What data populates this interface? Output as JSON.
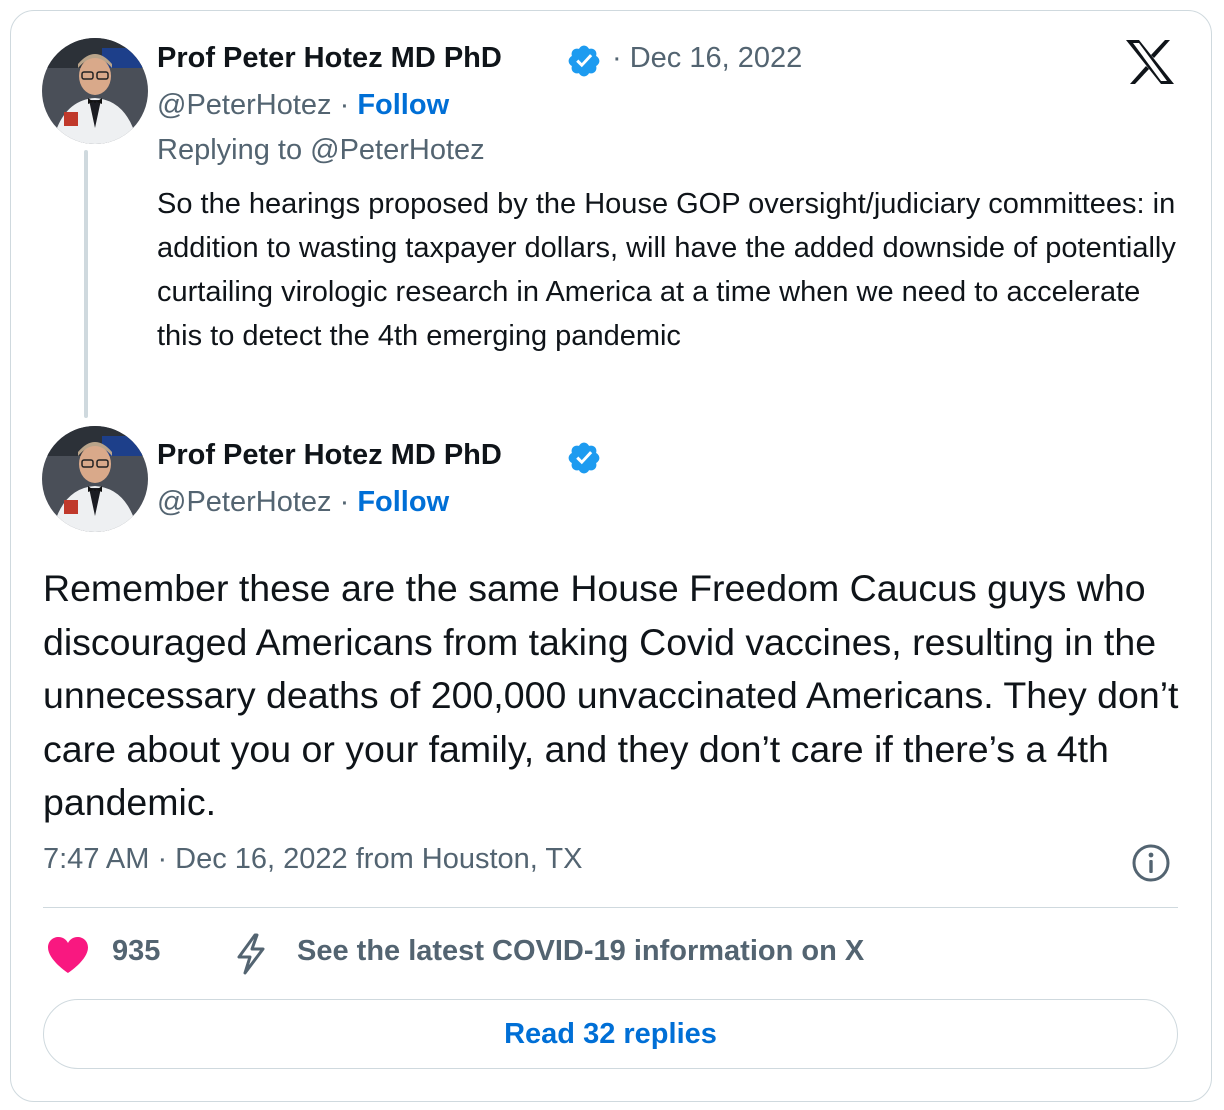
{
  "reply_tweet": {
    "author_name": "Prof Peter Hotez MD PhD",
    "handle": "@PeterHotez",
    "separator": "·",
    "follow_label": "Follow",
    "date": "Dec 16, 2022",
    "replying_to": "Replying to @PeterHotez",
    "text": "So the hearings proposed by the House GOP oversight/judiciary committees: in addition to wasting taxpayer dollars, will have the added downside of potentially curtailing virologic research in America at a time when we need to accelerate this to detect the 4th emerging pandemic"
  },
  "main_tweet": {
    "author_name": "Prof Peter Hotez MD PhD",
    "handle": "@PeterHotez",
    "separator": "·",
    "follow_label": "Follow",
    "text": "Remember these are the same House Freedom Caucus guys who discouraged Americans from taking Covid vaccines, resulting in the unnecessary deaths of 200,000 unvaccinated Americans. They don’t care about you or your family, and they don’t care if there’s a 4th pandemic.",
    "timestamp": "7:47 AM · Dec 16, 2022 from Houston, TX"
  },
  "actions": {
    "like_count": "935",
    "covid_info_label": "See the latest COVID-19 information on X",
    "read_replies_label": "Read 32 replies"
  },
  "icons": {
    "brand": "x-logo-icon",
    "verified": "verified-badge-icon",
    "info": "info-icon",
    "like": "heart-icon",
    "covid": "lightning-bolt-icon"
  },
  "colors": {
    "accent": "#006fd6",
    "verified": "#1d9bf0",
    "like": "#f91880",
    "muted": "#536471",
    "border": "#cfd9de"
  }
}
